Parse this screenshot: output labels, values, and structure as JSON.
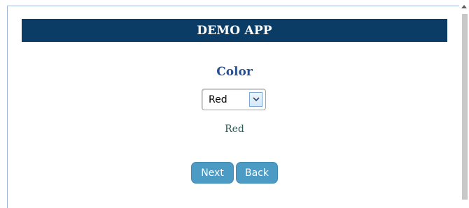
{
  "app": {
    "title": "DEMO APP"
  },
  "form": {
    "color_label": "Color",
    "color_select": {
      "value": "Red"
    },
    "selected_text": "Red"
  },
  "buttons": {
    "next_label": "Next",
    "back_label": "Back"
  },
  "colors": {
    "header_bg": "#0b3c66",
    "label_color": "#2a4f8f",
    "button_bg": "#4b9bc4",
    "selected_text_color": "#2e5a55"
  },
  "icons": {
    "dropdown": "chevron-down-icon",
    "scroll_up": "scroll-up-arrow-icon"
  }
}
